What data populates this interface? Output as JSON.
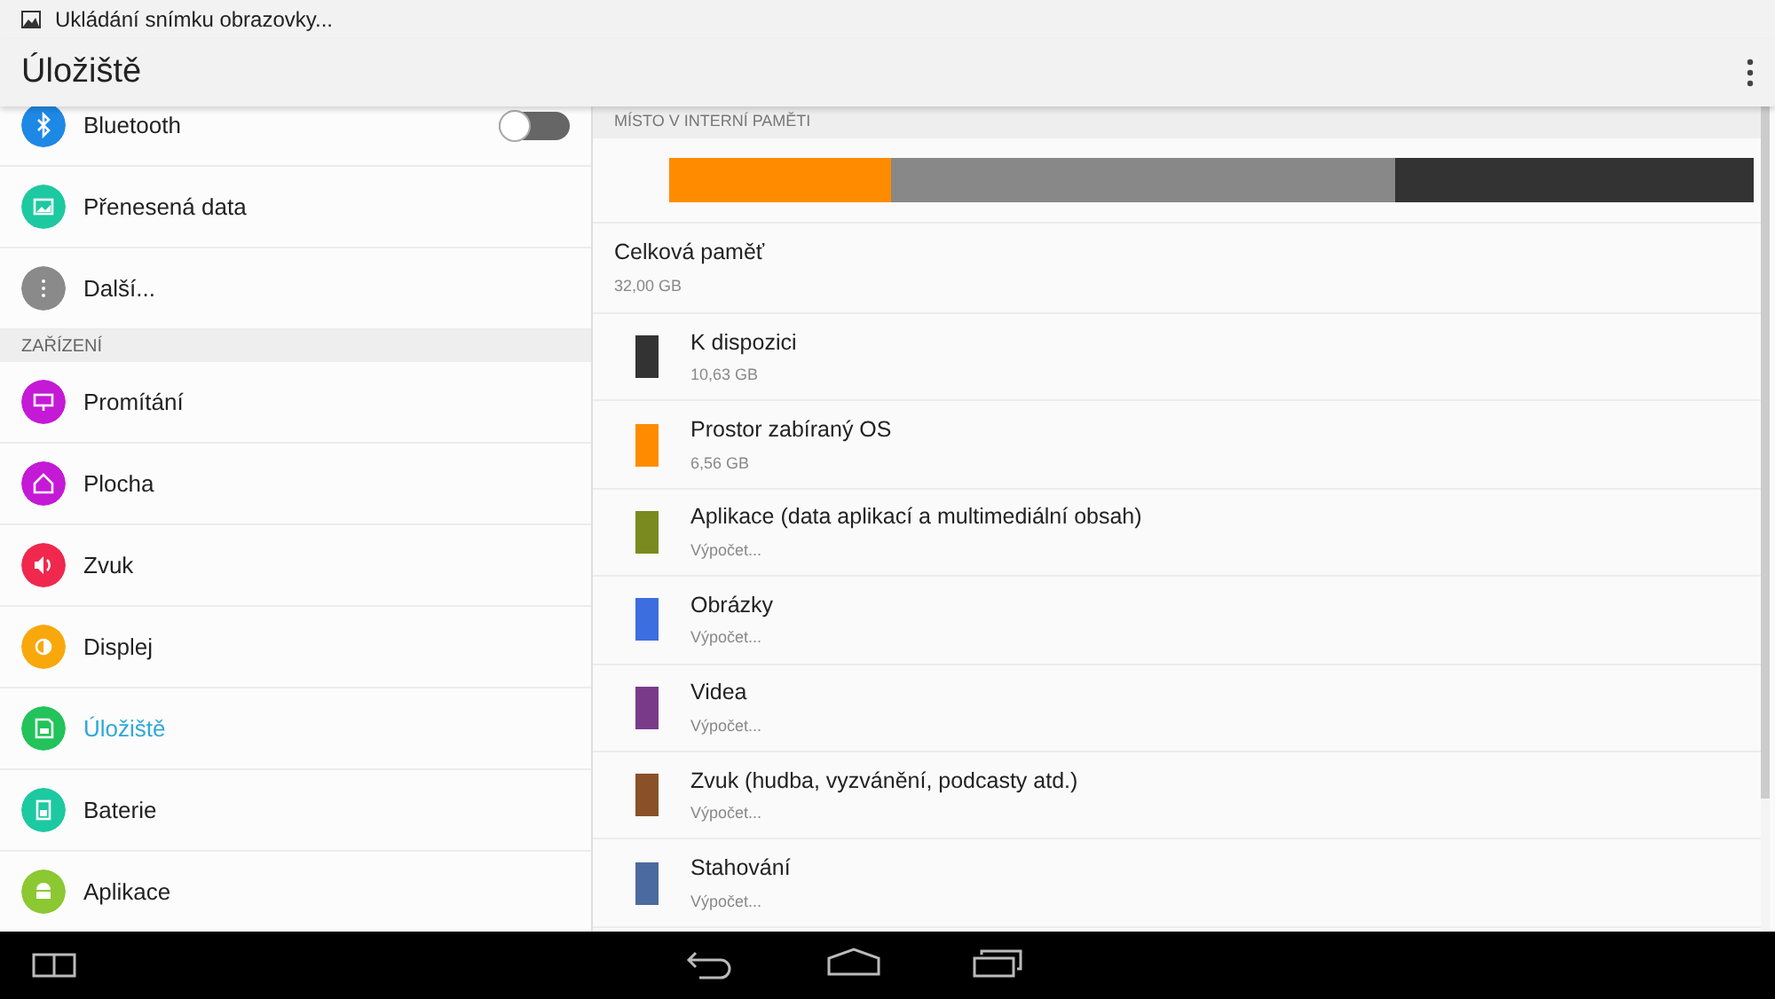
{
  "notification": {
    "text": "Ukládání snímku obrazovky..."
  },
  "app_bar": {
    "title": "Úložiště"
  },
  "sidebar": {
    "groups": [
      {
        "items": [
          {
            "label": "Bluetooth",
            "color": "#1e88e5",
            "toggle": {
              "on": false
            },
            "selected": false
          },
          {
            "label": "Přenesená data",
            "color": "#1dc9a0",
            "selected": false
          },
          {
            "label": "Další...",
            "color": "#8a8a8a",
            "selected": false
          }
        ]
      },
      {
        "header": "ZAŘÍZENÍ",
        "items": [
          {
            "label": "Promítání",
            "color": "#c41ad6",
            "selected": false
          },
          {
            "label": "Plocha",
            "color": "#c41ad6",
            "selected": false
          },
          {
            "label": "Zvuk",
            "color": "#f0284e",
            "selected": false
          },
          {
            "label": "Displej",
            "color": "#f9a80c",
            "selected": false
          },
          {
            "label": "Úložiště",
            "color": "#22c35a",
            "selected": true
          },
          {
            "label": "Baterie",
            "color": "#1dc9a0",
            "selected": false
          },
          {
            "label": "Aplikace",
            "color": "#8bc832",
            "selected": false
          }
        ]
      }
    ]
  },
  "storage": {
    "header": "MÍSTO V INTERNÍ PAMĚTI",
    "usage_bar": [
      {
        "color": "#ff8c00",
        "level": 0.205
      },
      {
        "color": "#888888",
        "level": 0.464
      },
      {
        "color": "#333333",
        "level": 0.331
      }
    ],
    "total": {
      "title": "Celková paměť",
      "value": "32,00 GB"
    },
    "categories": [
      {
        "title": "K dispozici",
        "value": "10,63 GB",
        "color": "#333333"
      },
      {
        "title": "Prostor zabíraný OS",
        "value": "6,56 GB",
        "color": "#ff8c00"
      },
      {
        "title": "Aplikace (data aplikací a multimediální obsah)",
        "value": "Výpočet...",
        "color": "#7a8a1e"
      },
      {
        "title": "Obrázky",
        "value": "Výpočet...",
        "color": "#3d6ee0"
      },
      {
        "title": "Videa",
        "value": "Výpočet...",
        "color": "#7a3a8a"
      },
      {
        "title": "Zvuk (hudba, vyzvánění, podcasty atd.)",
        "value": "Výpočet...",
        "color": "#8a5028"
      },
      {
        "title": "Stahování",
        "value": "Výpočet...",
        "color": "#4a6aa0"
      }
    ]
  }
}
